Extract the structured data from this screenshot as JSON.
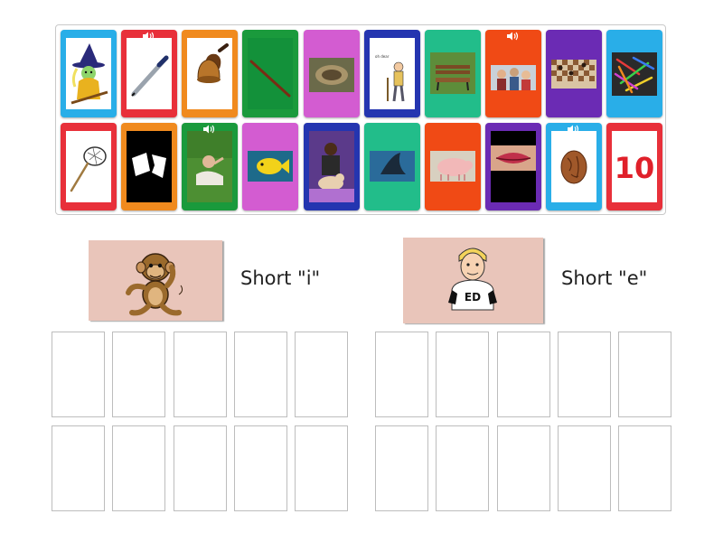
{
  "groups": [
    {
      "label": "Short \"i\"",
      "image": "monkey"
    },
    {
      "label": "Short \"e\"",
      "image": "boy-ed"
    }
  ],
  "colors": {
    "blue": "#29aee8",
    "red": "#e8303a",
    "orange": "#f08a1e",
    "green": "#1a9a3c",
    "pink": "#d35cd1",
    "navy": "#2435b0",
    "teal": "#22bd8a",
    "redorange": "#f04a15",
    "purple": "#6b2bb4",
    "header_bg": "#e9c5ba"
  },
  "cards": [
    {
      "image": "witch",
      "color": "blue",
      "audio": false
    },
    {
      "image": "pen",
      "color": "red",
      "audio": true
    },
    {
      "image": "bell",
      "color": "orange",
      "audio": false
    },
    {
      "image": "stick",
      "color": "green",
      "audio": false
    },
    {
      "image": "nest",
      "color": "pink",
      "audio": false
    },
    {
      "image": "sick-person",
      "color": "navy",
      "audio": false
    },
    {
      "image": "bench",
      "color": "teal",
      "audio": false
    },
    {
      "image": "friends",
      "color": "redorange",
      "audio": true
    },
    {
      "image": "chess",
      "color": "purple",
      "audio": false
    },
    {
      "image": "clips",
      "color": "blue",
      "audio": false
    },
    {
      "image": "net",
      "color": "red",
      "audio": false
    },
    {
      "image": "ripped-paper",
      "color": "orange",
      "audio": false
    },
    {
      "image": "man-on-grass",
      "color": "green",
      "audio": true
    },
    {
      "image": "fish",
      "color": "pink",
      "audio": false
    },
    {
      "image": "vet-dog",
      "color": "navy",
      "audio": false
    },
    {
      "image": "fin",
      "color": "teal",
      "audio": false
    },
    {
      "image": "pig",
      "color": "redorange",
      "audio": false
    },
    {
      "image": "lips",
      "color": "purple",
      "audio": false
    },
    {
      "image": "peach-pit",
      "color": "blue",
      "audio": true
    },
    {
      "image": "ten",
      "color": "red",
      "audio": false,
      "text": "10"
    }
  ]
}
